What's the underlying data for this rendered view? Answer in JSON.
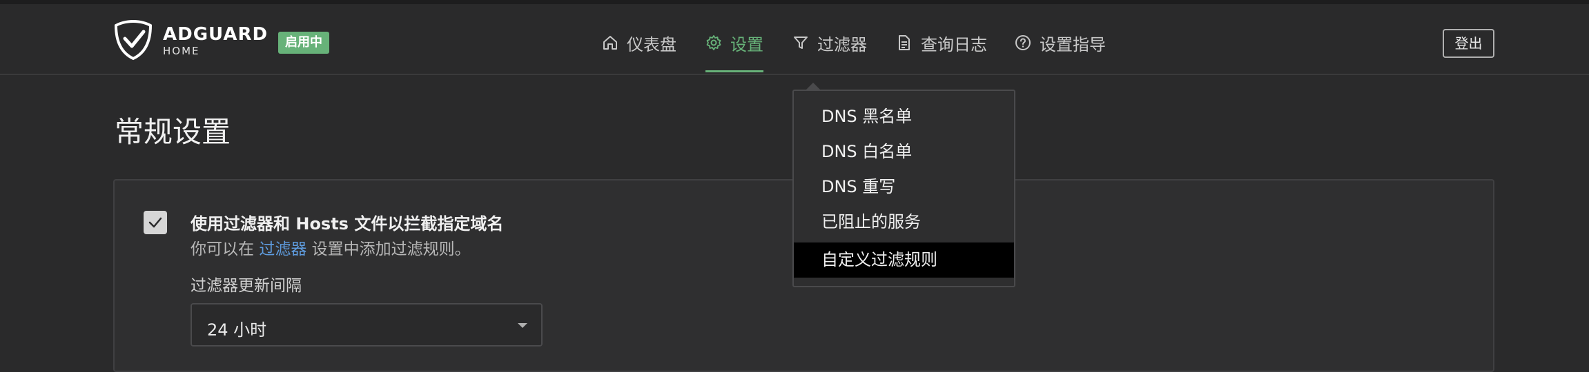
{
  "brand": {
    "name": "ADGUARD",
    "sub": "HOME",
    "status": "启用中"
  },
  "nav": {
    "items": [
      {
        "label": "仪表盘",
        "icon": "home-icon"
      },
      {
        "label": "设置",
        "icon": "gear-icon",
        "active": true
      },
      {
        "label": "过滤器",
        "icon": "filter-icon"
      },
      {
        "label": "查询日志",
        "icon": "document-icon"
      },
      {
        "label": "设置指导",
        "icon": "help-icon"
      }
    ],
    "logout_label": "登出"
  },
  "page": {
    "title": "常规设置"
  },
  "filtering": {
    "checked": true,
    "title": "使用过滤器和 Hosts 文件以拦截指定域名",
    "desc_prefix": "你可以在 ",
    "desc_link": "过滤器",
    "desc_suffix": " 设置中添加过滤规则。",
    "interval_label": "过滤器更新间隔",
    "interval_value": "24 小时"
  },
  "filters_menu": {
    "items": [
      "DNS 黑名单",
      "DNS 白名单",
      "DNS 重写",
      "已阻止的服务",
      "自定义过滤规则"
    ],
    "active_index": 4
  },
  "colors": {
    "accent": "#67b279",
    "link": "#5f9de0",
    "background": "#2a2a2b"
  }
}
